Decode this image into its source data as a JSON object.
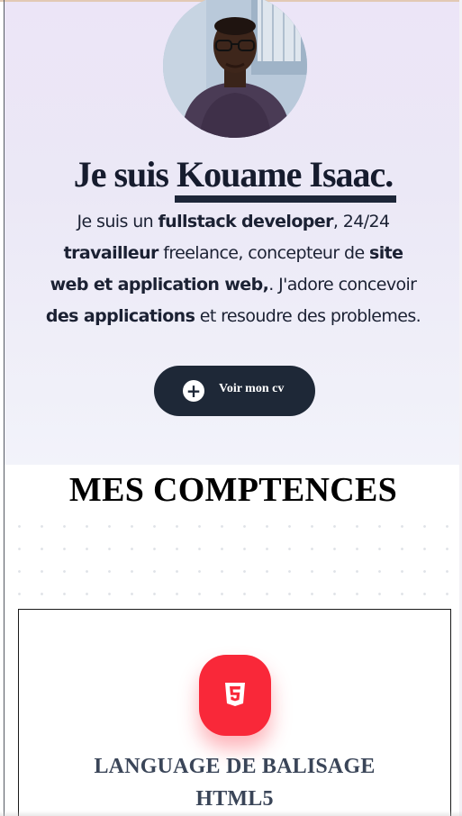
{
  "hero": {
    "title_prefix": "Je suis ",
    "title_name": "Kouame Isaac.",
    "text": [
      {
        "t": "Je suis un ",
        "b": false
      },
      {
        "t": "fullstack developer",
        "b": true
      },
      {
        "t": ", 24/24 ",
        "b": false
      },
      {
        "t": "travailleur",
        "b": true
      },
      {
        "t": " freelance, concepteur de ",
        "b": false
      },
      {
        "t": "site web et application web,",
        "b": true
      },
      {
        "t": ". J'adore concevoir ",
        "b": false
      },
      {
        "t": "des applications",
        "b": true
      },
      {
        "t": " et resoudre des problemes.",
        "b": false
      }
    ],
    "cv_button": {
      "icon": "plus",
      "label": "Voir mon cv"
    }
  },
  "skills": {
    "title": "MES COMPTENCES",
    "cards": [
      {
        "icon": "html5-icon",
        "name_line1": "LANGUAGE DE BALISAGE",
        "name_line2": "HTML5"
      }
    ]
  },
  "colors": {
    "dark": "#1e2837",
    "accent": "#f92839",
    "hero_bg": "#ece5f7"
  }
}
